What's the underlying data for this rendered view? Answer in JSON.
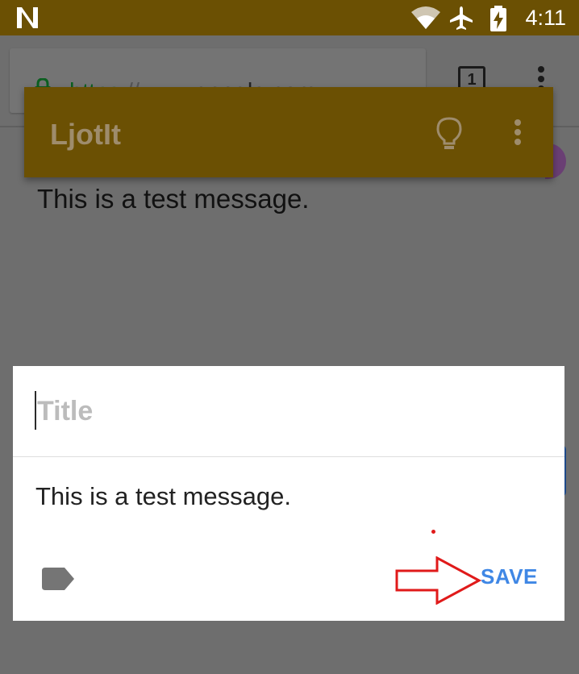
{
  "status_bar": {
    "time": "4:11",
    "icons": [
      "notification-n-icon",
      "wifi-icon",
      "airplane-mode-icon",
      "battery-charging-icon"
    ]
  },
  "browser": {
    "url_scheme": "https",
    "url_separator": "://",
    "url_host": "www.google.com",
    "tab_count": "1",
    "colors": {
      "url_scheme": "#0b5f20"
    }
  },
  "app": {
    "title": "LjotIt",
    "icons": [
      "lightbulb-icon",
      "overflow-menu-icon"
    ],
    "colors": {
      "toolbar": "#6b5003"
    }
  },
  "note_preview": {
    "text": "This is a test message."
  },
  "dialog": {
    "title_placeholder": "Title",
    "title_value": "",
    "body": "This is a test message.",
    "save_label": "SAVE",
    "icons": [
      "label-tag-icon"
    ],
    "annotation": {
      "arrow_color": "#e01a1a"
    },
    "colors": {
      "save": "#3f87e5"
    }
  }
}
